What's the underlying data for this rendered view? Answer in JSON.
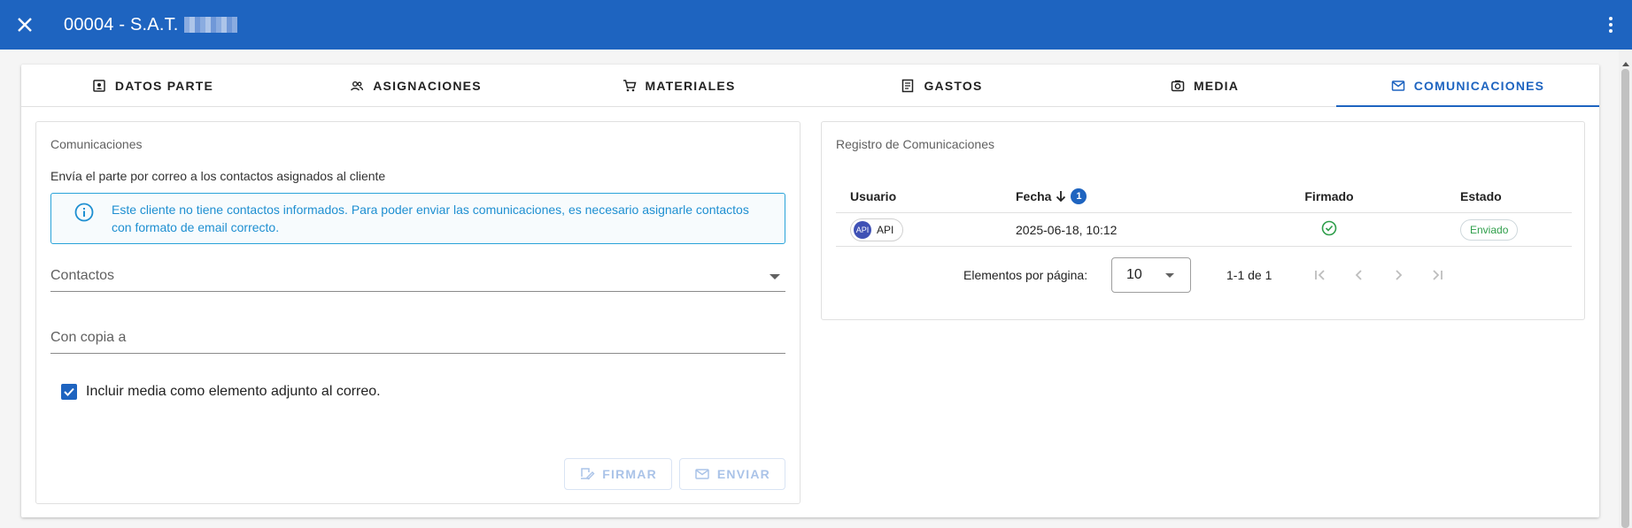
{
  "header": {
    "title": "00004 - S.A.T.",
    "close_icon": "close-icon",
    "menu_icon": "more-vert-icon"
  },
  "tabs": [
    {
      "label": "DATOS PARTE",
      "icon": "contact-card-icon",
      "active": false
    },
    {
      "label": "ASIGNACIONES",
      "icon": "people-icon",
      "active": false
    },
    {
      "label": "MATERIALES",
      "icon": "cart-icon",
      "active": false
    },
    {
      "label": "GASTOS",
      "icon": "receipt-icon",
      "active": false
    },
    {
      "label": "MEDIA",
      "icon": "camera-icon",
      "active": false
    },
    {
      "label": "COMUNICACIONES",
      "icon": "mail-icon",
      "active": true
    }
  ],
  "comunicaciones": {
    "title": "Comunicaciones",
    "description": "Envía el parte por correo a los contactos asignados al cliente",
    "alert": "Este cliente no tiene contactos informados. Para poder enviar las comunicaciones, es necesario asignarle contactos con formato de email correcto.",
    "contactos_label": "Contactos",
    "copia_label": "Con copia a",
    "checkbox_label": "Incluir media como elemento adjunto al correo.",
    "checkbox_checked": true,
    "firmar_label": "FIRMAR",
    "enviar_label": "ENVIAR"
  },
  "registro": {
    "title": "Registro de Comunicaciones",
    "columns": [
      "Usuario",
      "Fecha",
      "Firmado",
      "Estado"
    ],
    "sort_order": "1",
    "rows": [
      {
        "avatar": "API",
        "usuario": "API",
        "fecha": "2025-06-18, 10:12",
        "firmado": true,
        "estado": "Enviado"
      }
    ],
    "paginator": {
      "label": "Elementos por página:",
      "page_size": "10",
      "range": "1-1 de 1"
    }
  },
  "colors": {
    "primary": "#1e64c0",
    "info": "#1e8fd1",
    "success": "#2e9e4a"
  }
}
